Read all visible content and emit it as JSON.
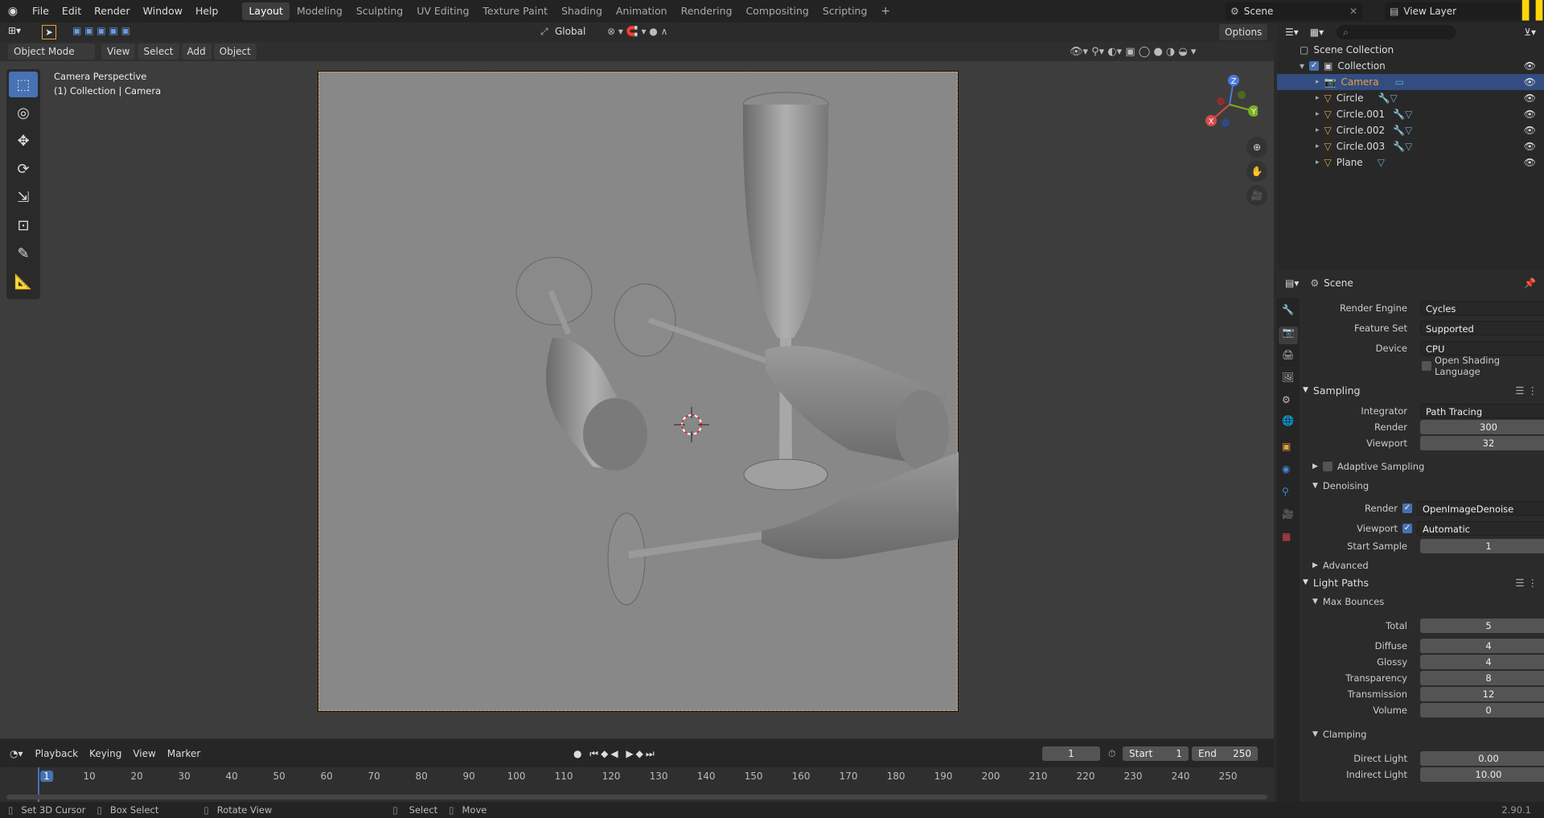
{
  "menu": [
    "File",
    "Edit",
    "Render",
    "Window",
    "Help"
  ],
  "workspaces": [
    "Layout",
    "Modeling",
    "Sculpting",
    "UV Editing",
    "Texture Paint",
    "Shading",
    "Animation",
    "Rendering",
    "Compositing",
    "Scripting"
  ],
  "active_workspace": "Layout",
  "scene_name": "Scene",
  "view_layer": "View Layer",
  "viewport": {
    "mode": "Object Mode",
    "menus": [
      "View",
      "Select",
      "Add",
      "Object"
    ],
    "transform_orientation": "Global",
    "options_label": "Options",
    "overlay_line1": "Camera Perspective",
    "overlay_line2": "(1) Collection | Camera",
    "gizmo": {
      "z": "Z",
      "y": "Y",
      "x": "X"
    }
  },
  "outliner": {
    "root": "Scene Collection",
    "collection": "Collection",
    "items": [
      "Camera",
      "Circle",
      "Circle.001",
      "Circle.002",
      "Circle.003",
      "Plane"
    ],
    "selected": "Camera"
  },
  "properties": {
    "header": "Scene",
    "render_engine_label": "Render Engine",
    "render_engine": "Cycles",
    "feature_set_label": "Feature Set",
    "feature_set": "Supported",
    "device_label": "Device",
    "device": "CPU",
    "osl_label": "Open Shading Language",
    "sampling": {
      "title": "Sampling",
      "integrator_label": "Integrator",
      "integrator": "Path Tracing",
      "render_label": "Render",
      "render": "300",
      "viewport_label": "Viewport",
      "viewport": "32",
      "adaptive": "Adaptive Sampling",
      "denoising": "Denoising",
      "den_render_label": "Render",
      "den_render": "OpenImageDenoise",
      "den_viewport_label": "Viewport",
      "den_viewport": "Automatic",
      "start_sample_label": "Start Sample",
      "start_sample": "1",
      "advanced": "Advanced"
    },
    "light_paths": {
      "title": "Light Paths",
      "max_bounces": "Max Bounces",
      "total_label": "Total",
      "total": "5",
      "diffuse_label": "Diffuse",
      "diffuse": "4",
      "glossy_label": "Glossy",
      "glossy": "4",
      "transparency_label": "Transparency",
      "transparency": "8",
      "transmission_label": "Transmission",
      "transmission": "12",
      "volume_label": "Volume",
      "volume": "0",
      "clamping": "Clamping",
      "direct_label": "Direct Light",
      "direct": "0.00",
      "indirect_label": "Indirect Light",
      "indirect": "10.00"
    }
  },
  "timeline": {
    "menus": [
      "Playback",
      "Keying",
      "View",
      "Marker"
    ],
    "current_frame": "1",
    "start_label": "Start",
    "start": "1",
    "end_label": "End",
    "end": "250",
    "ticks": [
      "1",
      "10",
      "20",
      "30",
      "40",
      "50",
      "60",
      "70",
      "80",
      "90",
      "100",
      "110",
      "120",
      "130",
      "140",
      "150",
      "160",
      "170",
      "180",
      "190",
      "200",
      "210",
      "220",
      "230",
      "240",
      "250"
    ]
  },
  "status": {
    "set_cursor": "Set 3D Cursor",
    "box_select": "Box Select",
    "rotate_view": "Rotate View",
    "select": "Select",
    "move": "Move",
    "version": "2.90.1"
  },
  "colors": {
    "accent": "#4772b3",
    "selected_row": "#334d80",
    "camera_frame": "#e0a060"
  }
}
